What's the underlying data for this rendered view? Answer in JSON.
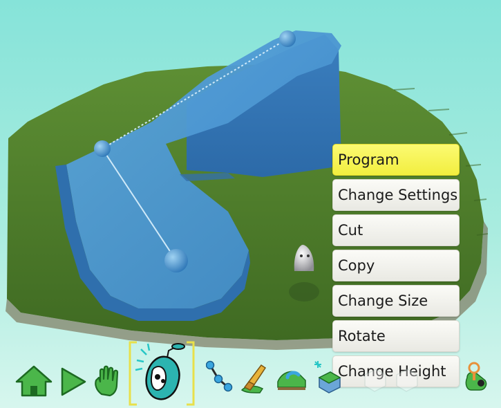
{
  "context_menu": {
    "items": [
      {
        "label": "Program",
        "highlighted": true
      },
      {
        "label": "Change Settings"
      },
      {
        "label": "Cut"
      },
      {
        "label": "Copy"
      },
      {
        "label": "Change Size"
      },
      {
        "label": "Rotate"
      },
      {
        "label": "Change Height"
      }
    ]
  },
  "toolbar": {
    "tools": [
      {
        "icon": "home-icon"
      },
      {
        "icon": "play-icon"
      },
      {
        "icon": "hand-icon"
      },
      {
        "icon": "kodu-character-icon",
        "selected": true
      },
      {
        "icon": "path-icon"
      },
      {
        "icon": "paint-brush-icon"
      },
      {
        "icon": "terrain-raise-icon"
      },
      {
        "icon": "terrain-sparkle-icon"
      },
      {
        "icon": "terrain-tool-icon"
      },
      {
        "icon": "terrain-tool-icon"
      },
      {
        "icon": "world-settings-icon"
      }
    ]
  },
  "colors": {
    "sky_top": "#86e3d9",
    "grass": "#4f7d2a",
    "water": "#3c8fd0",
    "menu_highlight": "#f2ee3f",
    "menu_item": "#efefe9",
    "selection_bracket": "#e8e04a"
  }
}
